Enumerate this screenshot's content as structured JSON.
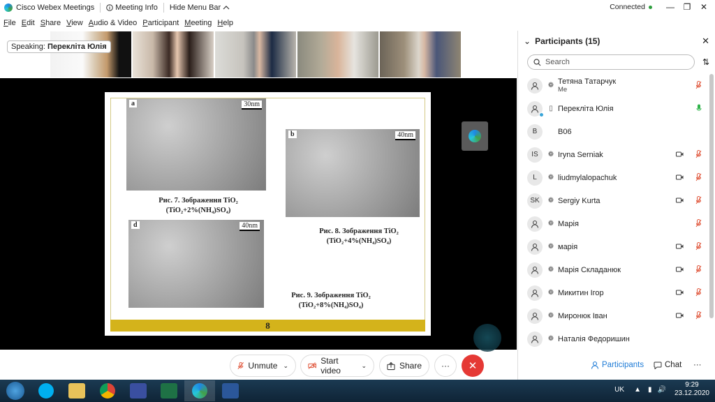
{
  "titlebar": {
    "app_name": "Cisco Webex Meetings",
    "meeting_info": "Meeting Info",
    "hide_menu": "Hide Menu Bar",
    "status": "Connected"
  },
  "menubar": [
    "File",
    "Edit",
    "Share",
    "View",
    "Audio & Video",
    "Participant",
    "Meeting",
    "Help"
  ],
  "speaking": {
    "label": "Speaking:",
    "name": "Перекліта Юлія"
  },
  "slide": {
    "panel_a_label": "a",
    "panel_a_scale": "30nm",
    "panel_b_label": "b",
    "panel_b_scale": "40nm",
    "panel_d_label": "d",
    "panel_d_scale": "40nm",
    "cap7_line1": "Рис. 7. Зображення  TiO₂",
    "cap7_line2": "(TiO₂+2%(NH₄)SO₄)",
    "cap8_line1": "Рис. 8.  Зображення  TiO₂",
    "cap8_line2": "(TiO₂+4%(NH₄)SO₄)",
    "cap9_line1": "Рис. 9.  Зображення  TiO₂",
    "cap9_line2": "(TiO₂+8%(NH₄)SO₄)",
    "page_number": "8"
  },
  "controls": {
    "unmute": "Unmute",
    "start_video": "Start video",
    "share": "Share",
    "more": "···"
  },
  "panel": {
    "title": "Participants (15)",
    "search_placeholder": "Search",
    "participants": [
      {
        "initials": "",
        "name": "Тетяна Татарчук",
        "sub": "Me",
        "device": "headset",
        "video": false,
        "mic": "muted"
      },
      {
        "initials": "",
        "name": "Перекліта Юлія",
        "sub": "",
        "device": "phone",
        "video": false,
        "mic": "active"
      },
      {
        "initials": "B",
        "name": "B06",
        "sub": "",
        "device": "",
        "video": false,
        "mic": "none"
      },
      {
        "initials": "IS",
        "name": "Iryna Serniak",
        "sub": "",
        "device": "headset",
        "video": true,
        "mic": "muted"
      },
      {
        "initials": "L",
        "name": "liudmylalopachuk",
        "sub": "",
        "device": "headset",
        "video": true,
        "mic": "muted"
      },
      {
        "initials": "SK",
        "name": "Sergiy Kurta",
        "sub": "",
        "device": "headset",
        "video": true,
        "mic": "muted"
      },
      {
        "initials": "",
        "name": "Марія",
        "sub": "",
        "device": "headset",
        "video": false,
        "mic": "muted"
      },
      {
        "initials": "",
        "name": "марія",
        "sub": "",
        "device": "headset",
        "video": true,
        "mic": "muted"
      },
      {
        "initials": "",
        "name": "Марія Складанюк",
        "sub": "",
        "device": "headset",
        "video": true,
        "mic": "muted"
      },
      {
        "initials": "",
        "name": "Микитин Ігор",
        "sub": "",
        "device": "headset",
        "video": true,
        "mic": "muted"
      },
      {
        "initials": "",
        "name": "Миронюк Іван",
        "sub": "",
        "device": "headset",
        "video": true,
        "mic": "muted"
      },
      {
        "initials": "",
        "name": "Наталія Федоришин",
        "sub": "",
        "device": "headset",
        "video": false,
        "mic": "none"
      }
    ]
  },
  "tabs": {
    "participants": "Participants",
    "chat": "Chat",
    "more": "···"
  },
  "tray": {
    "lang": "UK",
    "time": "9:29",
    "date": "23.12.2020"
  },
  "colors": {
    "accent": "#1e7bd6",
    "end_red": "#e53935",
    "muted_red": "#e0553a",
    "mic_green": "#2fb34a",
    "slide_bar": "#d4b31b"
  }
}
